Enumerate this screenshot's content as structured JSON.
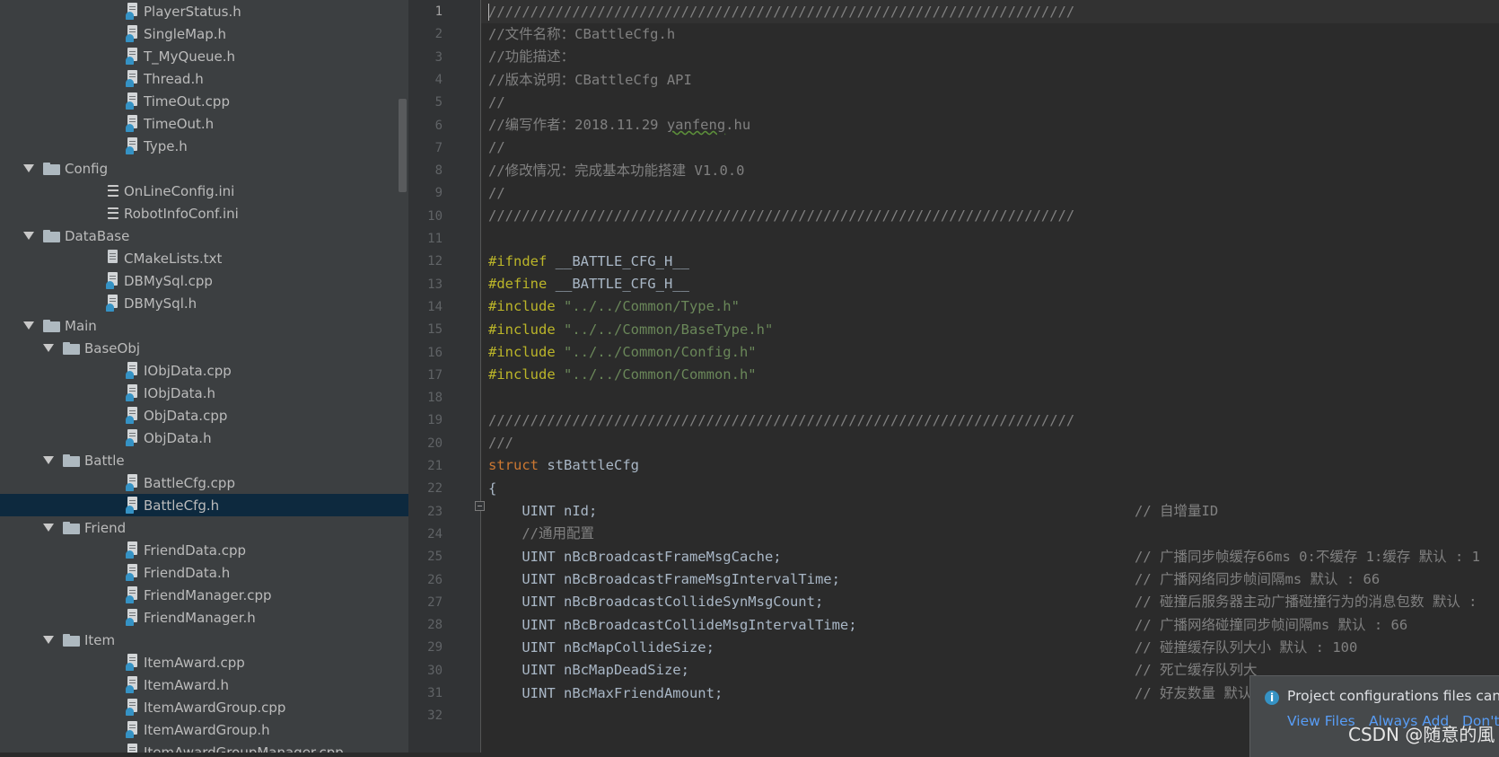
{
  "sidebar": {
    "rows": [
      {
        "label": "PlayerStatus.h",
        "type": "h"
      },
      {
        "label": "SingleMap.h",
        "type": "h"
      },
      {
        "label": "T_MyQueue.h",
        "type": "h"
      },
      {
        "label": "Thread.h",
        "type": "h"
      },
      {
        "label": "TimeOut.cpp",
        "type": "cpp"
      },
      {
        "label": "TimeOut.h",
        "type": "h"
      },
      {
        "label": "Type.h",
        "type": "h"
      },
      {
        "label": "Config",
        "type": "folder"
      },
      {
        "label": "OnLineConfig.ini",
        "type": "ini"
      },
      {
        "label": "RobotInfoConf.ini",
        "type": "ini"
      },
      {
        "label": "DataBase",
        "type": "folder"
      },
      {
        "label": "CMakeLists.txt",
        "type": "txt"
      },
      {
        "label": "DBMySql.cpp",
        "type": "cpp"
      },
      {
        "label": "DBMySql.h",
        "type": "h"
      },
      {
        "label": "Main",
        "type": "folder"
      },
      {
        "label": "BaseObj",
        "type": "folder"
      },
      {
        "label": "IObjData.cpp",
        "type": "cpp"
      },
      {
        "label": "IObjData.h",
        "type": "h"
      },
      {
        "label": "ObjData.cpp",
        "type": "cpp"
      },
      {
        "label": "ObjData.h",
        "type": "h"
      },
      {
        "label": "Battle",
        "type": "folder"
      },
      {
        "label": "BattleCfg.cpp",
        "type": "cpp"
      },
      {
        "label": "BattleCfg.h",
        "type": "h",
        "selected": true
      },
      {
        "label": "Friend",
        "type": "folder"
      },
      {
        "label": "FriendData.cpp",
        "type": "cpp"
      },
      {
        "label": "FriendData.h",
        "type": "h"
      },
      {
        "label": "FriendManager.cpp",
        "type": "cpp"
      },
      {
        "label": "FriendManager.h",
        "type": "h"
      },
      {
        "label": "Item",
        "type": "folder"
      },
      {
        "label": "ItemAward.cpp",
        "type": "cpp"
      },
      {
        "label": "ItemAward.h",
        "type": "h"
      },
      {
        "label": "ItemAwardGroup.cpp",
        "type": "cpp"
      },
      {
        "label": "ItemAwardGroup.h",
        "type": "h"
      },
      {
        "label": "ItemAwardGroupManager.cpp",
        "type": "cpp"
      }
    ]
  },
  "editor": {
    "line_numbers": [
      "1",
      "2",
      "3",
      "4",
      "5",
      "6",
      "7",
      "8",
      "9",
      "10",
      "11",
      "12",
      "13",
      "14",
      "15",
      "16",
      "17",
      "18",
      "19",
      "20",
      "21",
      "22",
      "23",
      "24",
      "25",
      "26",
      "27",
      "28",
      "29",
      "30",
      "31",
      "32"
    ],
    "current_line": "1",
    "slashes": "//////////////////////////////////////////////////////////////////////",
    "header": {
      "filename": "//文件名称：CBattleCfg.h",
      "func": "//功能描述：",
      "version": "//版本说明：CBattleCfg API",
      "blank": "//",
      "author_prefix": "//编写作者：2018.11.29 ",
      "author_name": "yanfeng",
      "author_suffix": ".hu",
      "modify": "//修改情况：完成基本功能搭建 V1.0.0"
    },
    "preproc": {
      "ifndef": "#ifndef",
      "guard": " __BATTLE_CFG_H__",
      "define": "#define",
      "include": "#include",
      "includes": [
        "\"../../Common/Type.h\"",
        "\"../../Common/BaseType.h\"",
        "\"../../Common/Config.h\"",
        "\"../../Common/Common.h\""
      ]
    },
    "doc_comment": "///",
    "struct_kw": "struct",
    "struct_name": " stBattleCfg",
    "brace": "{",
    "members": [
      {
        "code": "    UINT nId;",
        "comment": "// 自增量ID"
      },
      {
        "code": "    //通用配置",
        "comment": ""
      },
      {
        "code": "    UINT nBcBroadcastFrameMsgCache;",
        "comment": "// 广播同步帧缓存66ms 0:不缓存 1:缓存 默认 : 1"
      },
      {
        "code": "    UINT nBcBroadcastFrameMsgIntervalTime;",
        "comment": "// 广播网络同步帧间隔ms 默认 : 66"
      },
      {
        "code": "    UINT nBcBroadcastCollideSynMsgCount;",
        "comment": "// 碰撞后服务器主动广播碰撞行为的消息包数 默认 : "
      },
      {
        "code": "    UINT nBcBroadcastCollideMsgIntervalTime;",
        "comment": "// 广播网络碰撞同步帧间隔ms 默认 : 66"
      },
      {
        "code": "    UINT nBcMapCollideSize;",
        "comment": "// 碰撞缓存队列大小 默认 : 100"
      },
      {
        "code": "    UINT nBcMapDeadSize;",
        "comment": "// 死亡缓存队列大"
      },
      {
        "code": "    UINT nBcMaxFriendAmount;",
        "comment": "// 好友数量 默认"
      }
    ]
  },
  "notification": {
    "message": "Project configurations files can b",
    "view_files": "View Files",
    "always_add": "Always Add",
    "dont": "Don't"
  },
  "watermark": "CSDN @随意的風",
  "colors": {
    "sidebar_bg": "#3c3f41",
    "editor_bg": "#2b2b2b",
    "selected_row": "#0d293e",
    "keyword": "#cc7832",
    "directive": "#bbb529",
    "string": "#6a8759",
    "comment": "#808080",
    "link": "#589df6"
  }
}
